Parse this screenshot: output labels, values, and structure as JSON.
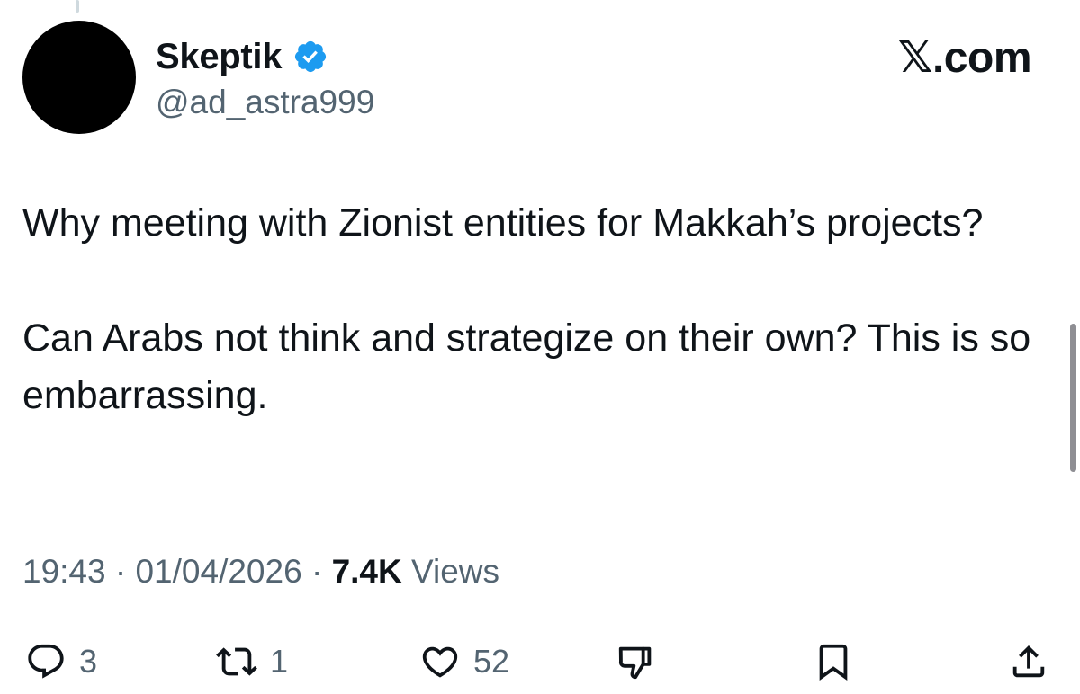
{
  "tweet": {
    "display_name": "Skeptik",
    "handle": "@ad_astra999",
    "verified_color": "#1d9bf0",
    "paragraphs": [
      "Why meeting with Zionist entities for Makkah’s projects?",
      "Can Arabs not think and strategize on their own? This is so embarrassing."
    ],
    "time": "19:43",
    "date": "01/04/2026",
    "views_count": "7.4K",
    "views_label": "Views",
    "separator": "·"
  },
  "watermark": "𝕏.com",
  "actions": {
    "reply": {
      "icon": "reply-icon",
      "count": "3"
    },
    "repost": {
      "icon": "repost-icon",
      "count": "1"
    },
    "like": {
      "icon": "heart-icon",
      "count": "52"
    },
    "dislike": {
      "icon": "thumbs-down-icon"
    },
    "bookmark": {
      "icon": "bookmark-icon"
    },
    "share": {
      "icon": "share-icon"
    }
  },
  "colors": {
    "text_primary": "#0f1419",
    "text_secondary": "#536471",
    "accent": "#1d9bf0"
  }
}
